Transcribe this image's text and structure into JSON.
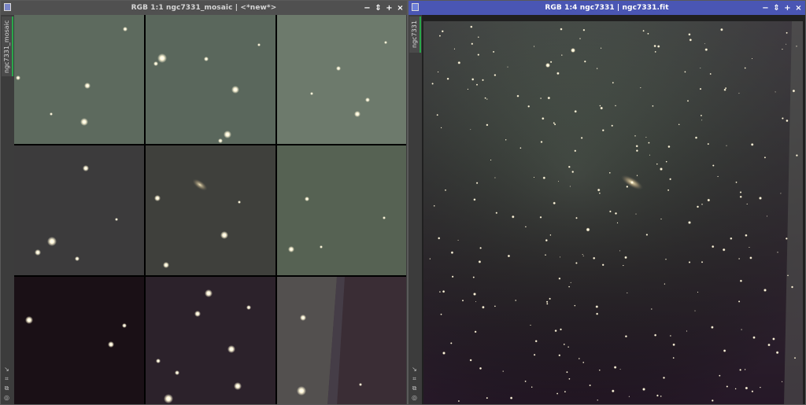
{
  "windows": {
    "left": {
      "title": "RGB 1:1 ngc7331_mosaic | <*new*>",
      "tab_label": "ngc7331_mosaic",
      "controls": [
        "−",
        "⇕",
        "+",
        "×"
      ]
    },
    "right": {
      "title": "RGB 1:4 ngc7331 | ngc7331.fit",
      "tab_label": "ngc7331",
      "controls": [
        "−",
        "⇕",
        "+",
        "×"
      ]
    }
  },
  "colors": {
    "active_titlebar": "#4a56b4",
    "inactive_titlebar": "#505050",
    "tab_accent": "#2aa74a"
  }
}
